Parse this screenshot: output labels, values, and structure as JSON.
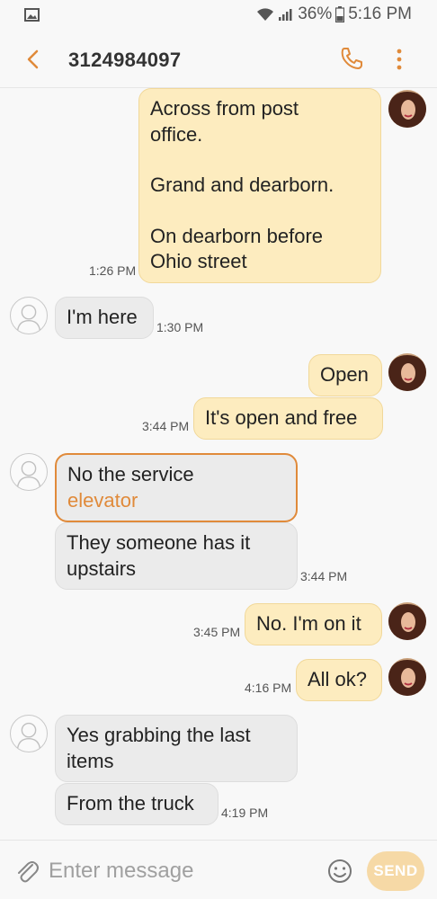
{
  "status_bar": {
    "battery": "36%",
    "time": "5:16 PM",
    "icons": [
      "gallery-icon",
      "wifi-icon",
      "signal-icon",
      "battery-icon"
    ]
  },
  "header": {
    "contact": "3124984097",
    "icons": [
      "back-arrow-icon",
      "phone-icon",
      "more-vertical-icon"
    ]
  },
  "messages": [
    {
      "direction": "outgoing",
      "lines": [
        "Across from post",
        "office.",
        "",
        "Grand and dearborn.",
        "",
        "On dearborn before",
        "Ohio street"
      ],
      "time": "1:26 PM"
    },
    {
      "direction": "incoming",
      "lines": [
        "I'm here"
      ],
      "time": "1:30 PM"
    },
    {
      "direction": "outgoing",
      "lines": [
        "Open"
      ]
    },
    {
      "direction": "outgoing",
      "lines": [
        "It's open and free"
      ],
      "time": "3:44 PM"
    },
    {
      "direction": "incoming",
      "lines": [
        "No the service",
        "elevator"
      ],
      "link_word": "elevator",
      "selected": true
    },
    {
      "direction": "incoming",
      "lines": [
        "They someone has it",
        "upstairs"
      ],
      "time": "3:44 PM"
    },
    {
      "direction": "outgoing",
      "lines": [
        "No. I'm on it"
      ],
      "time": "3:45 PM"
    },
    {
      "direction": "outgoing",
      "lines": [
        "All ok?"
      ],
      "time": "4:16 PM"
    },
    {
      "direction": "incoming",
      "lines": [
        "Yes grabbing the last",
        "items"
      ]
    },
    {
      "direction": "incoming",
      "lines": [
        "From the truck"
      ],
      "time": "4:19 PM"
    }
  ],
  "composer": {
    "placeholder": "Enter message",
    "send_label": "SEND",
    "icons": [
      "attach-icon",
      "emoji-icon"
    ]
  },
  "colors": {
    "accent": "#e08a3a",
    "outgoing_bubble": "#fdecbf",
    "incoming_bubble": "#ebebeb",
    "send_button": "#f6d9a6"
  }
}
